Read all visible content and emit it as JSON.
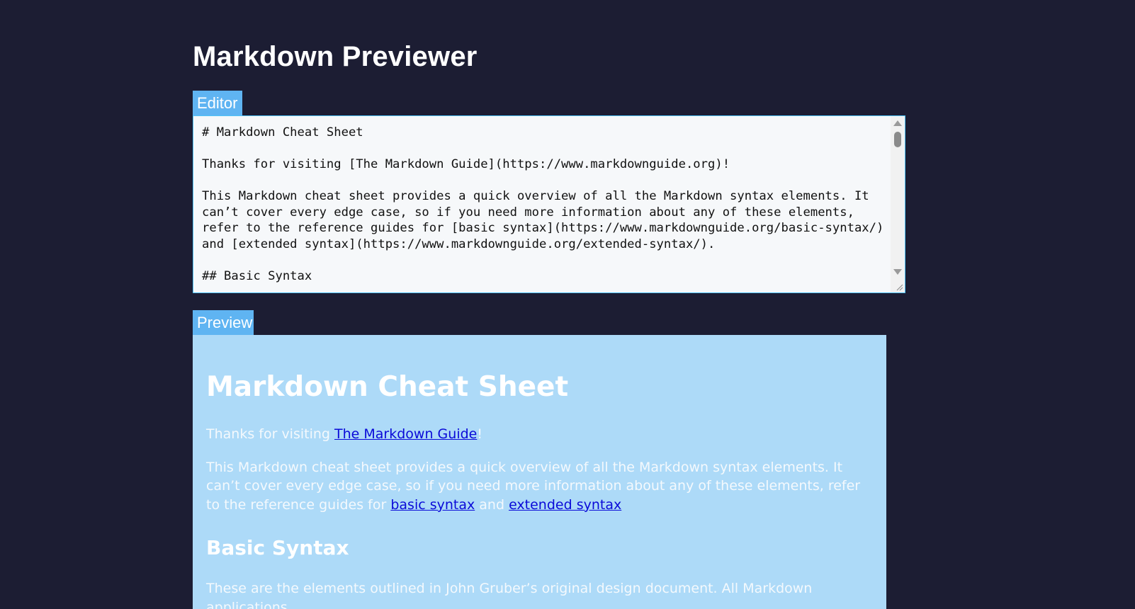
{
  "app": {
    "title": "Markdown Previewer"
  },
  "editor": {
    "label": "Editor",
    "content": "# Markdown Cheat Sheet\n\nThanks for visiting [The Markdown Guide](https://www.markdownguide.org)!\n\nThis Markdown cheat sheet provides a quick overview of all the Markdown syntax elements. It can’t cover every edge case, so if you need more information about any of these elements, refer to the reference guides for [basic syntax](https://www.markdownguide.org/basic-syntax/) and [extended syntax](https://www.markdownguide.org/extended-syntax/).\n\n## Basic Syntax"
  },
  "preview": {
    "label": "Preview",
    "heading1": "Markdown Cheat Sheet",
    "intro": {
      "before": "Thanks for visiting ",
      "link": "The Markdown Guide",
      "after": "!"
    },
    "overview": {
      "text": "This Markdown cheat sheet provides a quick overview of all the Markdown syntax elements. It can’t cover every edge case, so if you need more information about any of these elements, refer to the reference guides for ",
      "link1": "basic syntax",
      "middle": " and ",
      "link2": "extended syntax"
    },
    "heading2": "Basic Syntax",
    "basic_intro": "These are the elements outlined in John Gruber’s original design document. All Markdown applications"
  },
  "colors": {
    "background": "#1c1d33",
    "tab": "#5fb4f2",
    "preview_bg": "#addaf8",
    "link": "#0a0ad8",
    "editor_border": "#4fc3f7"
  }
}
